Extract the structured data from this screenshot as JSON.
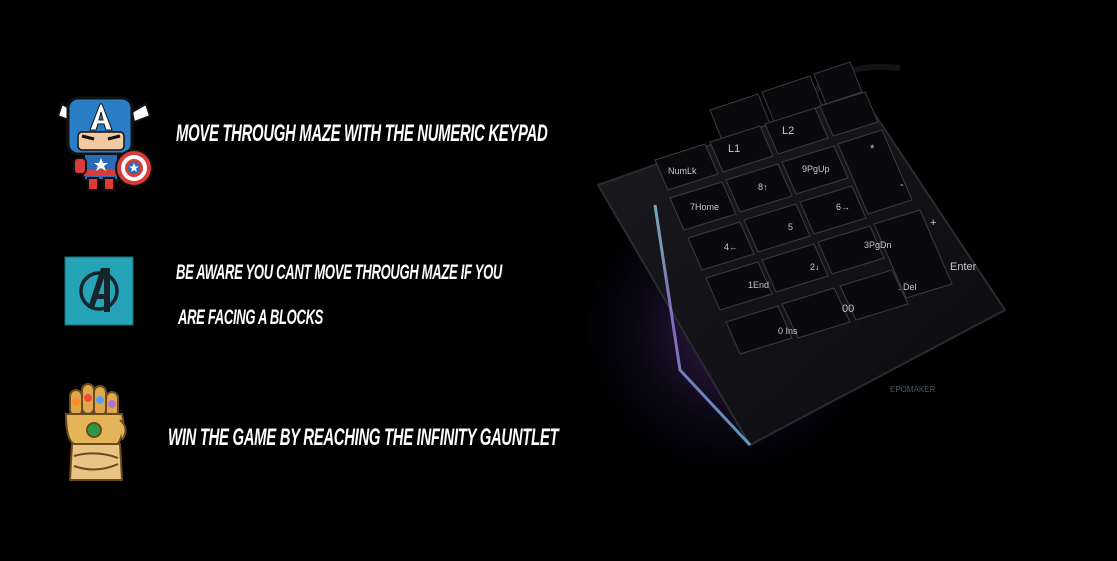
{
  "instructions": [
    {
      "icon": "captain-america-icon",
      "lines": [
        "Move through maze with the numeric keypad"
      ]
    },
    {
      "icon": "avengers-logo-icon",
      "lines": [
        "be aware you cant move through maze if you",
        "are facing A blocks"
      ]
    },
    {
      "icon": "infinity-gauntlet-icon",
      "lines": [
        "Win the game by reaching the infinity gauntlet"
      ]
    }
  ],
  "keypad": {
    "keys": {
      "l1": "L1",
      "l2": "L2",
      "numlk": "NumLk",
      "star": "*",
      "minus": "-",
      "plus": "+",
      "k7": "7Home",
      "k8": "8↑",
      "k9": "9PgUp",
      "k4": "4←",
      "k5": "5",
      "k6": "6→",
      "k1": "1End",
      "k2": "2↓",
      "k3": "3PgDn",
      "k0": "0 Ins",
      "k00": "00",
      "del": ". Del",
      "enter": "Enter"
    },
    "brand": "EPOMAKER"
  },
  "colors": {
    "background": "#000000",
    "text": "#ffffff",
    "shield_blue": "#1f7fc4",
    "avengers_teal": "#27a3b8",
    "gauntlet_gold": "#d9a64a"
  }
}
